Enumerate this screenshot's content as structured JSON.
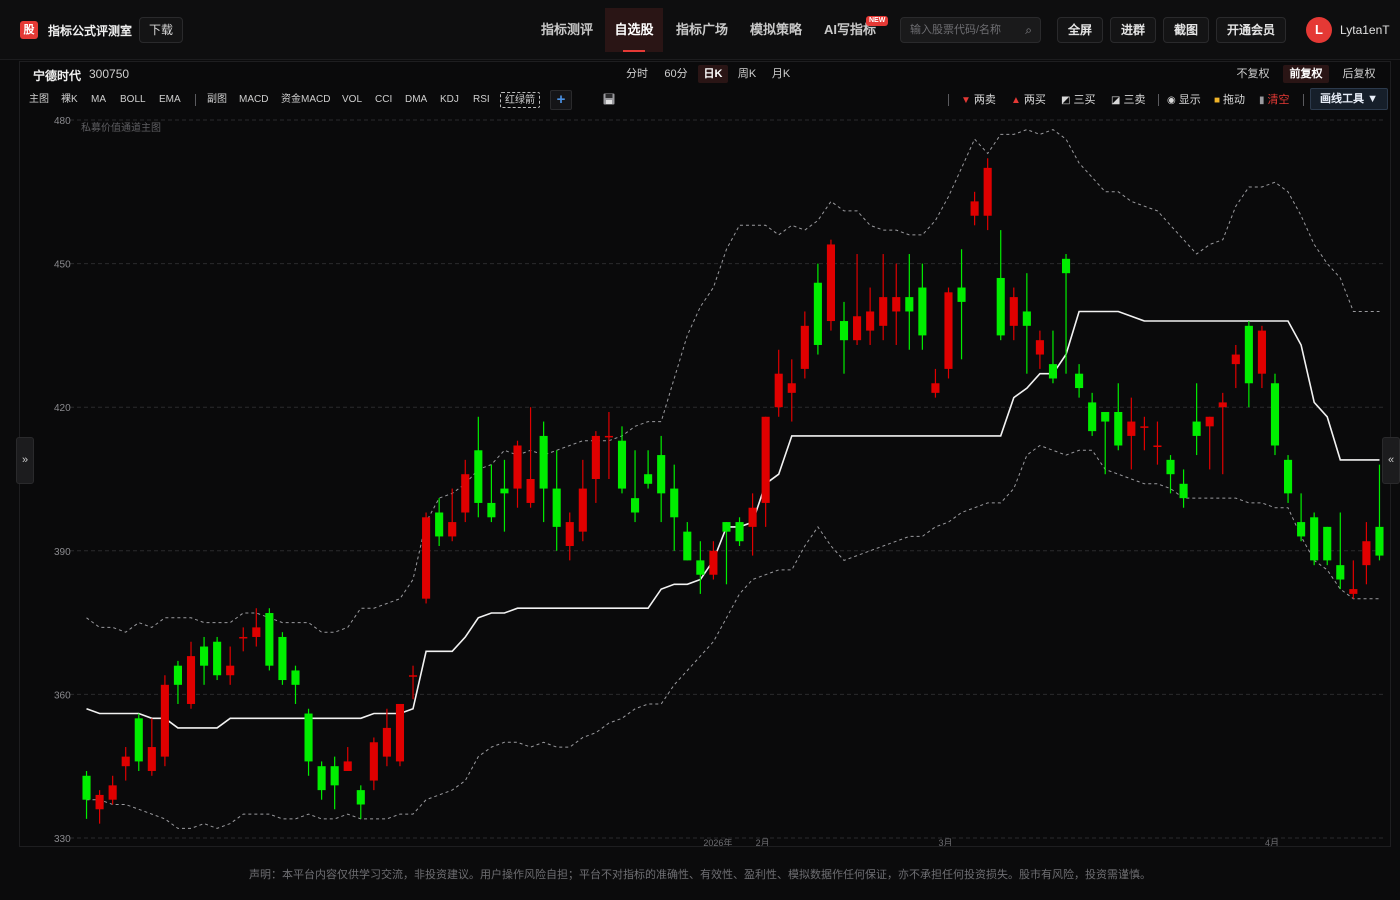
{
  "header": {
    "logo_char": "股",
    "app_title": "指标公式评测室",
    "download_label": "下载",
    "nav_tabs": [
      "指标测评",
      "自选股",
      "指标广场",
      "模拟策略",
      "AI写指标"
    ],
    "new_badge": "NEW",
    "search_placeholder": "输入股票代码/名称",
    "buttons": [
      "全屏",
      "进群",
      "截图",
      "开通会员"
    ],
    "avatar_letter": "L",
    "username": "Lyta1enT"
  },
  "stock": {
    "name": "宁德时代",
    "code": "300750"
  },
  "periods": [
    "分时",
    "60分",
    "日K",
    "周K",
    "月K"
  ],
  "active_period": "日K",
  "adjust": [
    "不复权",
    "前复权",
    "后复权"
  ],
  "active_adjust": "前复权",
  "indicators_main": [
    "主图",
    "裸K",
    "MA",
    "BOLL",
    "EMA"
  ],
  "indicators_sub": [
    "副图",
    "MACD",
    "资金MACD",
    "VOL",
    "CCI",
    "DMA",
    "KDJ",
    "RSI",
    "红绿箭"
  ],
  "draw_tools": [
    {
      "label": "两卖",
      "icon": "down-triangle-icon",
      "color": "#e53935"
    },
    {
      "label": "两买",
      "icon": "up-triangle-icon",
      "color": "#e53935"
    },
    {
      "label": "三买",
      "icon": "trend-up-icon",
      "color": "#d8d8d8"
    },
    {
      "label": "三卖",
      "icon": "trend-down-icon",
      "color": "#d8d8d8"
    },
    {
      "label": "显示",
      "icon": "eye-icon",
      "color": "#d8d8d8"
    },
    {
      "label": "拖动",
      "icon": "lock-icon",
      "color": "#f0b429"
    },
    {
      "label": "清空",
      "icon": "trash-icon",
      "color": "#e53935"
    }
  ],
  "draw_tool_button": "画线工具 ▼",
  "left_edge": "»",
  "right_edge": "«",
  "footer": "声明：本平台内容仅供学习交流，非投资建议。用户操作风险自担；平台不对指标的准确性、有效性、盈利性、模拟数据作任何保证，亦不承担任何投资损失。股市有风险，投资需谨慎。",
  "chart_data": {
    "type": "candlestick",
    "overlay_label": "私募价值通道主图",
    "y_ticks": [
      480,
      450,
      420,
      390,
      360,
      330
    ],
    "ylim": [
      330,
      480
    ],
    "x_labels": [
      "2026年",
      "2月",
      "3月",
      "4月"
    ],
    "x_label_positions": [
      48,
      52,
      66,
      91
    ],
    "up_color": "#e00000",
    "down_color": "#00ee00",
    "candles": [
      {
        "o": 343,
        "c": 338,
        "h": 344,
        "l": 334
      },
      {
        "o": 336,
        "c": 339,
        "h": 340,
        "l": 333
      },
      {
        "o": 338,
        "c": 341,
        "h": 343,
        "l": 337
      },
      {
        "o": 345,
        "c": 347,
        "h": 349,
        "l": 342
      },
      {
        "o": 355,
        "c": 346,
        "h": 356,
        "l": 344
      },
      {
        "o": 344,
        "c": 349,
        "h": 355,
        "l": 343
      },
      {
        "o": 347,
        "c": 362,
        "h": 364,
        "l": 345
      },
      {
        "o": 366,
        "c": 362,
        "h": 367,
        "l": 358
      },
      {
        "o": 358,
        "c": 368,
        "h": 371,
        "l": 357
      },
      {
        "o": 370,
        "c": 366,
        "h": 372,
        "l": 362
      },
      {
        "o": 371,
        "c": 364,
        "h": 372,
        "l": 363
      },
      {
        "o": 364,
        "c": 366,
        "h": 370,
        "l": 362
      },
      {
        "o": 372,
        "c": 372,
        "h": 374,
        "l": 369
      },
      {
        "o": 372,
        "c": 374,
        "h": 378,
        "l": 370
      },
      {
        "o": 377,
        "c": 366,
        "h": 378,
        "l": 365
      },
      {
        "o": 372,
        "c": 363,
        "h": 373,
        "l": 362
      },
      {
        "o": 365,
        "c": 362,
        "h": 366,
        "l": 358
      },
      {
        "o": 356,
        "c": 346,
        "h": 357,
        "l": 343
      },
      {
        "o": 345,
        "c": 340,
        "h": 346,
        "l": 338
      },
      {
        "o": 345,
        "c": 341,
        "h": 347,
        "l": 336
      },
      {
        "o": 344,
        "c": 346,
        "h": 349,
        "l": 344
      },
      {
        "o": 340,
        "c": 337,
        "h": 341,
        "l": 334
      },
      {
        "o": 342,
        "c": 350,
        "h": 351,
        "l": 340
      },
      {
        "o": 347,
        "c": 353,
        "h": 357,
        "l": 345
      },
      {
        "o": 346,
        "c": 358,
        "h": 358,
        "l": 345
      },
      {
        "o": 364,
        "c": 364,
        "h": 366,
        "l": 359
      },
      {
        "o": 380,
        "c": 397,
        "h": 398,
        "l": 379
      },
      {
        "o": 398,
        "c": 393,
        "h": 401,
        "l": 391
      },
      {
        "o": 393,
        "c": 396,
        "h": 403,
        "l": 392
      },
      {
        "o": 398,
        "c": 406,
        "h": 409,
        "l": 396
      },
      {
        "o": 411,
        "c": 400,
        "h": 418,
        "l": 397
      },
      {
        "o": 400,
        "c": 397,
        "h": 408,
        "l": 396
      },
      {
        "o": 403,
        "c": 402,
        "h": 409,
        "l": 394
      },
      {
        "o": 403,
        "c": 412,
        "h": 413,
        "l": 399
      },
      {
        "o": 400,
        "c": 405,
        "h": 420,
        "l": 399
      },
      {
        "o": 414,
        "c": 403,
        "h": 417,
        "l": 396
      },
      {
        "o": 403,
        "c": 395,
        "h": 411,
        "l": 390
      },
      {
        "o": 391,
        "c": 396,
        "h": 398,
        "l": 388
      },
      {
        "o": 394,
        "c": 403,
        "h": 409,
        "l": 392
      },
      {
        "o": 405,
        "c": 414,
        "h": 415,
        "l": 400
      },
      {
        "o": 414,
        "c": 414,
        "h": 419,
        "l": 405
      },
      {
        "o": 413,
        "c": 403,
        "h": 416,
        "l": 402
      },
      {
        "o": 401,
        "c": 398,
        "h": 411,
        "l": 396
      },
      {
        "o": 406,
        "c": 404,
        "h": 411,
        "l": 403
      },
      {
        "o": 410,
        "c": 402,
        "h": 414,
        "l": 396
      },
      {
        "o": 403,
        "c": 397,
        "h": 408,
        "l": 390
      },
      {
        "o": 394,
        "c": 388,
        "h": 396,
        "l": 388
      },
      {
        "o": 388,
        "c": 385,
        "h": 392,
        "l": 381
      },
      {
        "o": 385,
        "c": 390,
        "h": 392,
        "l": 384
      },
      {
        "o": 396,
        "c": 394,
        "h": 396,
        "l": 383
      },
      {
        "o": 396,
        "c": 392,
        "h": 397,
        "l": 391
      },
      {
        "o": 395,
        "c": 399,
        "h": 402,
        "l": 389
      },
      {
        "o": 400,
        "c": 418,
        "h": 418,
        "l": 395
      },
      {
        "o": 420,
        "c": 427,
        "h": 432,
        "l": 418
      },
      {
        "o": 423,
        "c": 425,
        "h": 430,
        "l": 417
      },
      {
        "o": 428,
        "c": 437,
        "h": 440,
        "l": 426
      },
      {
        "o": 446,
        "c": 433,
        "h": 450,
        "l": 431
      },
      {
        "o": 438,
        "c": 454,
        "h": 455,
        "l": 436
      },
      {
        "o": 438,
        "c": 434,
        "h": 442,
        "l": 427
      },
      {
        "o": 434,
        "c": 439,
        "h": 452,
        "l": 433
      },
      {
        "o": 436,
        "c": 440,
        "h": 445,
        "l": 433
      },
      {
        "o": 437,
        "c": 443,
        "h": 452,
        "l": 434
      },
      {
        "o": 440,
        "c": 443,
        "h": 450,
        "l": 433
      },
      {
        "o": 443,
        "c": 440,
        "h": 452,
        "l": 432
      },
      {
        "o": 445,
        "c": 435,
        "h": 450,
        "l": 432
      },
      {
        "o": 423,
        "c": 425,
        "h": 428,
        "l": 422
      },
      {
        "o": 428,
        "c": 444,
        "h": 445,
        "l": 426
      },
      {
        "o": 445,
        "c": 442,
        "h": 453,
        "l": 430
      },
      {
        "o": 460,
        "c": 463,
        "h": 465,
        "l": 458
      },
      {
        "o": 460,
        "c": 470,
        "h": 472,
        "l": 457
      },
      {
        "o": 447,
        "c": 435,
        "h": 457,
        "l": 434
      },
      {
        "o": 437,
        "c": 443,
        "h": 445,
        "l": 434
      },
      {
        "o": 440,
        "c": 437,
        "h": 448,
        "l": 427
      },
      {
        "o": 431,
        "c": 434,
        "h": 436,
        "l": 428
      },
      {
        "o": 429,
        "c": 426,
        "h": 436,
        "l": 425
      },
      {
        "o": 451,
        "c": 448,
        "h": 452,
        "l": 427
      },
      {
        "o": 427,
        "c": 424,
        "h": 429,
        "l": 422
      },
      {
        "o": 421,
        "c": 415,
        "h": 423,
        "l": 414
      },
      {
        "o": 419,
        "c": 417,
        "h": 419,
        "l": 406
      },
      {
        "o": 419,
        "c": 412,
        "h": 425,
        "l": 411
      },
      {
        "o": 414,
        "c": 417,
        "h": 422,
        "l": 407
      },
      {
        "o": 416,
        "c": 416,
        "h": 418,
        "l": 411
      },
      {
        "o": 412,
        "c": 412,
        "h": 417,
        "l": 408
      },
      {
        "o": 409,
        "c": 406,
        "h": 410,
        "l": 402
      },
      {
        "o": 404,
        "c": 401,
        "h": 407,
        "l": 399
      },
      {
        "o": 417,
        "c": 414,
        "h": 425,
        "l": 410
      },
      {
        "o": 416,
        "c": 418,
        "h": 418,
        "l": 407
      },
      {
        "o": 420,
        "c": 421,
        "h": 423,
        "l": 406
      },
      {
        "o": 429,
        "c": 431,
        "h": 433,
        "l": 424
      },
      {
        "o": 437,
        "c": 425,
        "h": 438,
        "l": 420
      },
      {
        "o": 427,
        "c": 436,
        "h": 437,
        "l": 424
      },
      {
        "o": 425,
        "c": 412,
        "h": 427,
        "l": 410
      },
      {
        "o": 409,
        "c": 402,
        "h": 410,
        "l": 400
      },
      {
        "o": 396,
        "c": 393,
        "h": 402,
        "l": 392
      },
      {
        "o": 397,
        "c": 388,
        "h": 398,
        "l": 387
      },
      {
        "o": 395,
        "c": 388,
        "h": 395,
        "l": 387
      },
      {
        "o": 387,
        "c": 384,
        "h": 398,
        "l": 382
      },
      {
        "o": 381,
        "c": 382,
        "h": 388,
        "l": 380
      },
      {
        "o": 387,
        "c": 392,
        "h": 396,
        "l": 383
      },
      {
        "o": 395,
        "c": 389,
        "h": 408,
        "l": 388
      }
    ],
    "channel_upper": [
      376,
      374,
      374,
      373,
      375,
      374,
      376,
      376,
      376,
      375,
      375,
      375,
      377,
      377,
      376,
      375,
      375,
      375,
      373,
      373,
      374,
      378,
      378,
      379,
      380,
      384,
      396,
      401,
      402,
      404,
      407,
      408,
      411,
      410,
      411,
      410,
      411,
      412,
      413,
      413,
      413,
      414,
      416,
      417,
      417,
      426,
      435,
      441,
      445,
      453,
      458,
      458,
      458,
      456,
      458,
      457,
      459,
      463,
      461,
      461,
      458,
      457,
      457,
      456,
      456,
      459,
      464,
      470,
      476,
      473,
      477,
      477,
      478,
      477,
      478,
      476,
      471,
      468,
      465,
      465,
      463,
      462,
      461,
      458,
      455,
      452,
      454,
      455,
      462,
      466,
      466,
      467,
      465,
      460,
      454,
      450,
      447,
      440,
      440,
      440
    ],
    "channel_mid": [
      357,
      356,
      356,
      356,
      356,
      355,
      355,
      353,
      353,
      353,
      353,
      355,
      355,
      355,
      355,
      355,
      355,
      355,
      355,
      355,
      355,
      355,
      356,
      356,
      356,
      357,
      369,
      369,
      369,
      372,
      376,
      377,
      377,
      378,
      378,
      378,
      378,
      378,
      378,
      378,
      378,
      378,
      378,
      378,
      382,
      383,
      383,
      384,
      388,
      395,
      395,
      396,
      404,
      406,
      414,
      414,
      414,
      414,
      414,
      414,
      414,
      414,
      414,
      414,
      414,
      414,
      414,
      414,
      414,
      414,
      414,
      422,
      424,
      427,
      427,
      431,
      440,
      440,
      440,
      440,
      439,
      438,
      438,
      438,
      438,
      438,
      438,
      438,
      438,
      438,
      438,
      438,
      438,
      433,
      421,
      418,
      409,
      409,
      409,
      409
    ],
    "channel_lower": [
      338,
      338,
      337,
      337,
      336,
      335,
      334,
      332,
      332,
      333,
      332,
      333,
      335,
      335,
      335,
      334,
      334,
      335,
      334,
      334,
      335,
      334,
      334,
      334,
      335,
      335,
      338,
      339,
      340,
      342,
      347,
      349,
      350,
      350,
      349,
      350,
      349,
      349,
      351,
      352,
      354,
      355,
      357,
      358,
      358,
      362,
      365,
      368,
      371,
      376,
      381,
      384,
      385,
      386,
      386,
      391,
      395,
      391,
      388,
      389,
      390,
      391,
      392,
      393,
      393,
      395,
      396,
      398,
      399,
      400,
      400,
      403,
      410,
      412,
      411,
      410,
      411,
      411,
      407,
      406,
      405,
      404,
      404,
      403,
      401,
      401,
      401,
      401,
      401,
      400,
      400,
      399,
      399,
      393,
      388,
      386,
      382,
      380,
      380,
      380
    ]
  }
}
